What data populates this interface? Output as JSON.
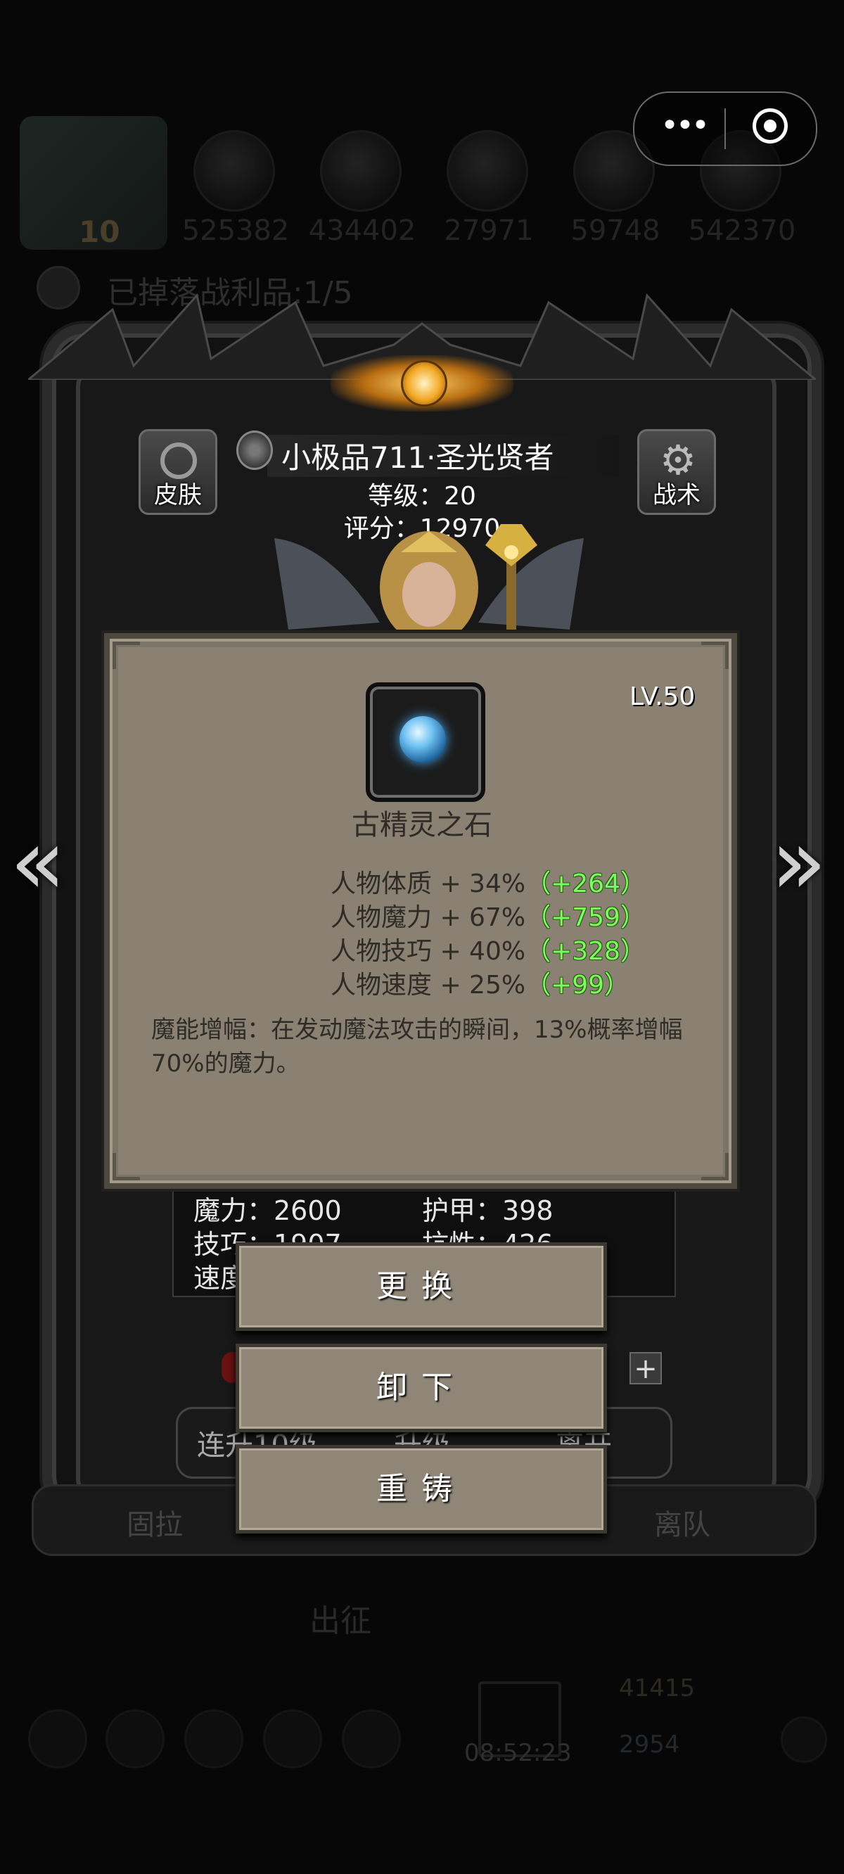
{
  "background": {
    "resources": [
      "525382",
      "434402",
      "27971",
      "59748",
      "542370"
    ],
    "level_badge": "10",
    "drop_text": "已掉落战利品:1/5",
    "deploy_text": "出征",
    "timer": "08:52:23",
    "gold": "41415",
    "gems": "2954"
  },
  "hero": {
    "name": "小极品711·圣光贤者",
    "level_text": "等级：20",
    "score_text": "评分：12970",
    "skin_label": "皮肤",
    "tactics_label": "战术"
  },
  "stats": {
    "magic": "魔力：2600",
    "armor": "护甲：398",
    "skill": "技巧：1907",
    "resist": "抗性：426",
    "speed": "速度"
  },
  "tabs": [
    "连升10级",
    "升级",
    "离开"
  ],
  "bottom_left": "固拉",
  "bottom_right": "离队",
  "item": {
    "level": "LV.50",
    "name": "古精灵之石",
    "attributes": [
      {
        "text": "人物体质 + 34%",
        "bonus": "（+264）"
      },
      {
        "text": "人物魔力 + 67%",
        "bonus": "（+759）"
      },
      {
        "text": "人物技巧 + 40%",
        "bonus": "（+328）"
      },
      {
        "text": "人物速度 + 25%",
        "bonus": "（+99）"
      }
    ],
    "description": "魔能增幅：在发动魔法攻击的瞬间，13%概率增幅70%的魔力。"
  },
  "actions": {
    "replace": "更换",
    "unequip": "卸下",
    "reforge": "重铸"
  },
  "colors": {
    "bonus_green": "#7aff5a",
    "tooltip_bg": "#8a8173",
    "button_bg": "#8f8677"
  }
}
